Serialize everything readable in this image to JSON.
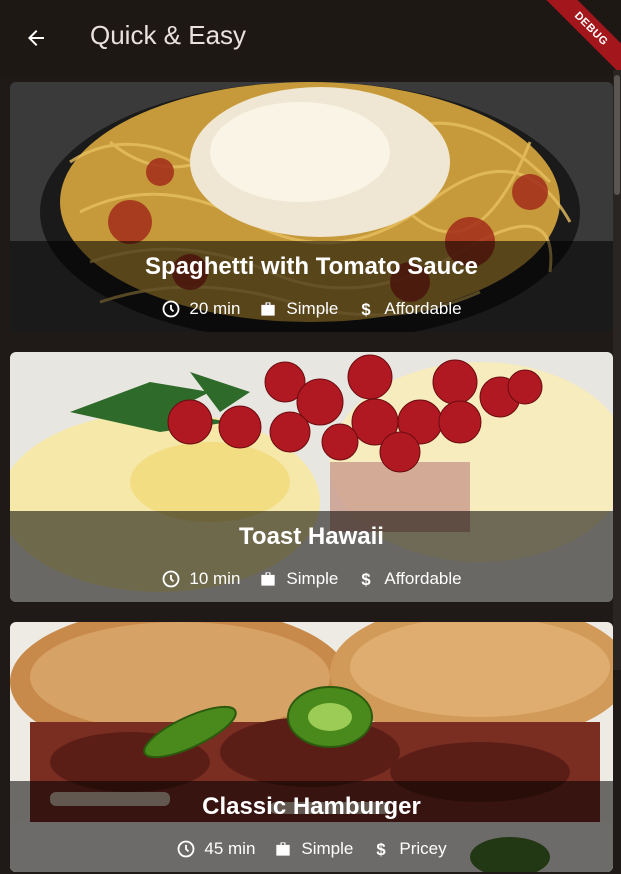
{
  "appbar": {
    "title": "Quick & Easy",
    "debug_label": "DEBUG"
  },
  "meals": [
    {
      "title": "Spaghetti with Tomato Sauce",
      "duration": "20 min",
      "complexity": "Simple",
      "affordability": "Affordable"
    },
    {
      "title": "Toast Hawaii",
      "duration": "10 min",
      "complexity": "Simple",
      "affordability": "Affordable"
    },
    {
      "title": "Classic Hamburger",
      "duration": "45 min",
      "complexity": "Simple",
      "affordability": "Pricey"
    }
  ]
}
